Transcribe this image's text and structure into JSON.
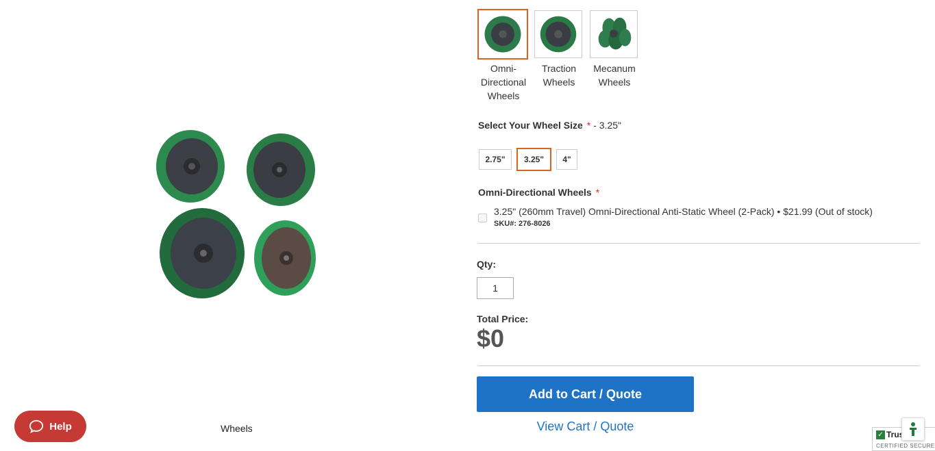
{
  "wheel_types": [
    {
      "label": "Omni-Directional Wheels",
      "selected": true
    },
    {
      "label": "Traction Wheels",
      "selected": false
    },
    {
      "label": "Mecanum Wheels",
      "selected": false
    }
  ],
  "size_select": {
    "heading": "Select Your Wheel Size",
    "required_mark": "*",
    "selected_text": "- 3.25\"",
    "options": [
      "2.75\"",
      "3.25\"",
      "4\""
    ],
    "selected_index": 1
  },
  "omni_section": {
    "heading": "Omni-Directional Wheels",
    "required_mark": "*",
    "option_text": "3.25\" (260mm Travel) Omni-Directional Anti-Static Wheel (2-Pack) • $21.99 (Out of stock)",
    "option_sku": "SKU#: 276-8026"
  },
  "qty": {
    "label": "Qty:",
    "value": "1"
  },
  "total": {
    "label": "Total Price:",
    "value": "$0"
  },
  "actions": {
    "add_to_cart": "Add to Cart / Quote",
    "view_cart": "View Cart / Quote"
  },
  "image_caption": "Wheels",
  "help": {
    "label": "Help"
  },
  "trust_badge": {
    "title": "Trus",
    "subtitle": "CERTIFIED SECURE"
  },
  "colors": {
    "accent": "#e0601f",
    "primary": "#1f73c6",
    "help": "#c63a35",
    "required": "#e02b27"
  }
}
